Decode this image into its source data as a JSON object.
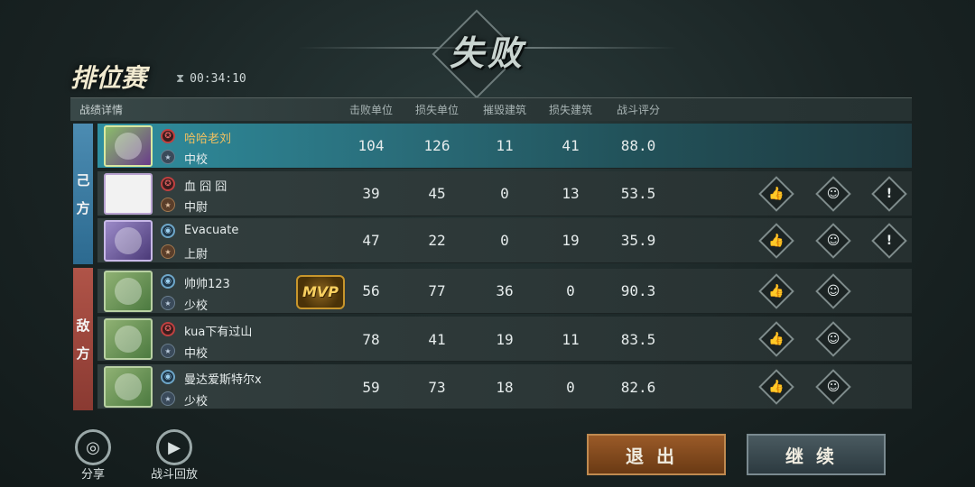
{
  "header": {
    "result_title": "失败",
    "mode_title": "排位赛",
    "timer": "00:34:10"
  },
  "table": {
    "section_label": "战绩详情",
    "columns": [
      "击败单位",
      "损失单位",
      "摧毁建筑",
      "损失建筑",
      "战斗评分"
    ]
  },
  "teams": {
    "own_label": [
      "己",
      "方"
    ],
    "enemy_label": [
      "敌",
      "方"
    ]
  },
  "players": [
    {
      "name": "哈哈老刘",
      "rank": "中校",
      "kills": "104",
      "losses": "126",
      "destroyed": "11",
      "lost_buildings": "41",
      "score": "88.0"
    },
    {
      "name": "血 囧 囧",
      "rank": "中尉",
      "kills": "39",
      "losses": "45",
      "destroyed": "0",
      "lost_buildings": "13",
      "score": "53.5"
    },
    {
      "name": "Evacuate",
      "rank": "上尉",
      "kills": "47",
      "losses": "22",
      "destroyed": "0",
      "lost_buildings": "19",
      "score": "35.9"
    },
    {
      "name": "帅帅123",
      "rank": "少校",
      "kills": "56",
      "losses": "77",
      "destroyed": "36",
      "lost_buildings": "0",
      "score": "90.3"
    },
    {
      "name": "kua下有过山",
      "rank": "中校",
      "kills": "78",
      "losses": "41",
      "destroyed": "19",
      "lost_buildings": "11",
      "score": "83.5"
    },
    {
      "name": "曼达爱斯特尔x",
      "rank": "少校",
      "kills": "59",
      "losses": "73",
      "destroyed": "18",
      "lost_buildings": "0",
      "score": "82.6"
    }
  ],
  "mvp_label": "MVP",
  "bottom": {
    "share_label": "分享",
    "replay_label": "战斗回放",
    "exit_label": "退出",
    "continue_label": "继续"
  },
  "colors": {
    "own_team": "#3f7fa6",
    "enemy_team": "#a04a40",
    "highlight_row": "#2f8fa0",
    "exit_button": "#8a4e20"
  }
}
